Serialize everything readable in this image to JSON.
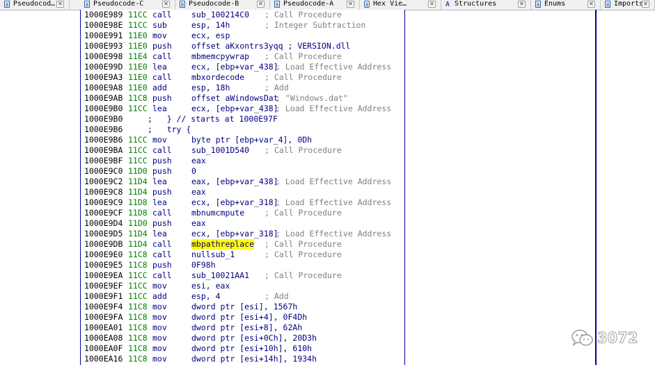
{
  "tabs": [
    {
      "label": "Pseudocod…",
      "icon": "document-icon"
    },
    {
      "label": "Pseudocode-C",
      "icon": "document-icon"
    },
    {
      "label": "Pseudocode-B",
      "icon": "document-icon"
    },
    {
      "label": "Pseudocode-A",
      "icon": "document-icon"
    },
    {
      "label": "Hex Vie…",
      "icon": "hex-view-icon"
    },
    {
      "label": "Structures",
      "icon": "structures-icon",
      "glyph": "A"
    },
    {
      "label": "Enums",
      "icon": "enums-icon"
    },
    {
      "label": "Imports",
      "icon": "imports-icon"
    }
  ],
  "close_glyph": "×",
  "listing": [
    {
      "addr": "1000E989",
      "sp": "11CC",
      "mn": "call",
      "op": "sub_100214C0",
      "cm": "; Call Procedure"
    },
    {
      "addr": "1000E98E",
      "sp": "11CC",
      "mn": "sub",
      "op": "esp, 14h",
      "cm": "; Integer Subtraction"
    },
    {
      "addr": "1000E991",
      "sp": "11E0",
      "mn": "mov",
      "op": "ecx, esp",
      "cm": ""
    },
    {
      "addr": "1000E993",
      "sp": "11E0",
      "mn": "push",
      "op": "offset aKxontrs3yqq ; VERSION.dll",
      "cm": ""
    },
    {
      "addr": "1000E998",
      "sp": "11E4",
      "mn": "call",
      "op": "mbmemcpywrap",
      "cm": "; Call Procedure"
    },
    {
      "addr": "1000E99D",
      "sp": "11E0",
      "mn": "lea",
      "op": "ecx, [ebp+var_438]",
      "cm": "; Load Effective Address"
    },
    {
      "addr": "1000E9A3",
      "sp": "11E0",
      "mn": "call",
      "op": "mbxordecode",
      "cm": "; Call Procedure"
    },
    {
      "addr": "1000E9A8",
      "sp": "11E0",
      "mn": "add",
      "op": "esp, 18h",
      "cm": "; Add"
    },
    {
      "addr": "1000E9AB",
      "sp": "11C8",
      "mn": "push",
      "op": "offset aWindowsDat",
      "cm": "; \"Windows.dat\""
    },
    {
      "addr": "1000E9B0",
      "sp": "11CC",
      "mn": "lea",
      "op": "ecx, [ebp+var_438]",
      "cm": "; Load Effective Address"
    },
    {
      "addr": "1000E9B0",
      "note": ";   } // starts at 1000E97F"
    },
    {
      "addr": "1000E9B6",
      "note": ";   try {"
    },
    {
      "addr": "1000E9B6",
      "sp": "11CC",
      "mn": "mov",
      "op": "byte ptr [ebp+var_4], 0Dh",
      "cm": ""
    },
    {
      "addr": "1000E9BA",
      "sp": "11CC",
      "mn": "call",
      "op": "sub_1001D540",
      "cm": "; Call Procedure"
    },
    {
      "addr": "1000E9BF",
      "sp": "11CC",
      "mn": "push",
      "op": "eax",
      "cm": ""
    },
    {
      "addr": "1000E9C0",
      "sp": "11D0",
      "mn": "push",
      "op": "0",
      "cm": ""
    },
    {
      "addr": "1000E9C2",
      "sp": "11D4",
      "mn": "lea",
      "op": "eax, [ebp+var_438]",
      "cm": "; Load Effective Address"
    },
    {
      "addr": "1000E9C8",
      "sp": "11D4",
      "mn": "push",
      "op": "eax",
      "cm": ""
    },
    {
      "addr": "1000E9C9",
      "sp": "11D8",
      "mn": "lea",
      "op": "ecx, [ebp+var_318]",
      "cm": "; Load Effective Address"
    },
    {
      "addr": "1000E9CF",
      "sp": "11D8",
      "mn": "call",
      "op": "mbnumcmpute",
      "cm": "; Call Procedure"
    },
    {
      "addr": "1000E9D4",
      "sp": "11D0",
      "mn": "push",
      "op": "eax",
      "cm": ""
    },
    {
      "addr": "1000E9D5",
      "sp": "11D4",
      "mn": "lea",
      "op": "ecx, [ebp+var_318]",
      "cm": "; Load Effective Address"
    },
    {
      "addr": "1000E9DB",
      "sp": "11D4",
      "mn": "call",
      "op": "mbpathreplace",
      "cm": "; Call Procedure",
      "highlight": true
    },
    {
      "addr": "1000E9E0",
      "sp": "11C8",
      "mn": "call",
      "op": "nullsub_1",
      "cm": "; Call Procedure"
    },
    {
      "addr": "1000E9E5",
      "sp": "11C8",
      "mn": "push",
      "op": "0F98h",
      "cm": ""
    },
    {
      "addr": "1000E9EA",
      "sp": "11CC",
      "mn": "call",
      "op": "sub_10021AA1",
      "cm": "; Call Procedure"
    },
    {
      "addr": "1000E9EF",
      "sp": "11CC",
      "mn": "mov",
      "op": "esi, eax",
      "cm": ""
    },
    {
      "addr": "1000E9F1",
      "sp": "11CC",
      "mn": "add",
      "op": "esp, 4",
      "cm": "; Add"
    },
    {
      "addr": "1000E9F4",
      "sp": "11C8",
      "mn": "mov",
      "op": "dword ptr [esi], 1567h",
      "cm": ""
    },
    {
      "addr": "1000E9FA",
      "sp": "11C8",
      "mn": "mov",
      "op": "dword ptr [esi+4], 0F4Dh",
      "cm": ""
    },
    {
      "addr": "1000EA01",
      "sp": "11C8",
      "mn": "mov",
      "op": "dword ptr [esi+8], 62Ah",
      "cm": ""
    },
    {
      "addr": "1000EA08",
      "sp": "11C8",
      "mn": "mov",
      "op": "dword ptr [esi+0Ch], 20D3h",
      "cm": ""
    },
    {
      "addr": "1000EA0F",
      "sp": "11C8",
      "mn": "mov",
      "op": "dword ptr [esi+10h], 610h",
      "cm": ""
    },
    {
      "addr": "1000EA16",
      "sp": "11C8",
      "mn": "mov",
      "op": "dword ptr [esi+14h], 1934h",
      "cm": ""
    }
  ],
  "watermark": {
    "text": "3072",
    "icon": "wechat-icon"
  },
  "colors": {
    "address": "#000000",
    "stack": "#008000",
    "code": "#000080",
    "comment": "#808080",
    "highlight": "#ffff00",
    "border": "#0000a0"
  }
}
